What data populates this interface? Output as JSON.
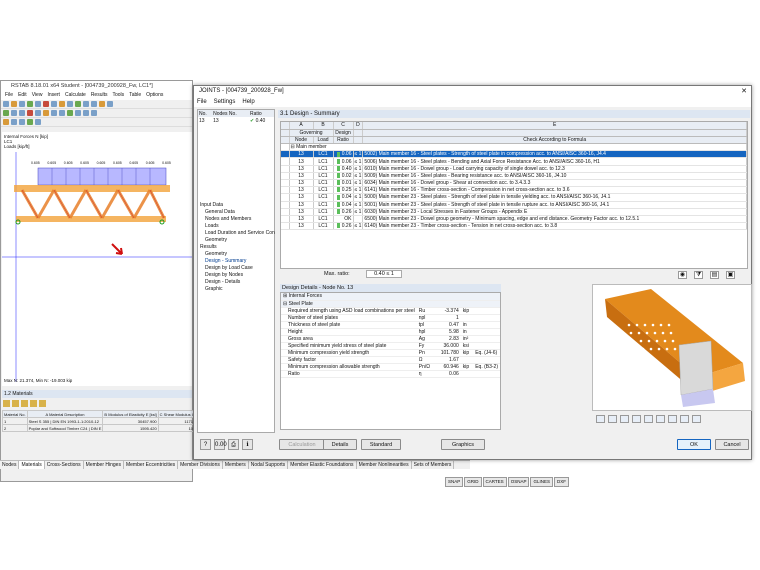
{
  "app": {
    "title": "RSTAB 8.18.01 x64 Student - [004739_200928_Fw, LC1*]",
    "menu": [
      "File",
      "Edit",
      "View",
      "Insert",
      "Calculate",
      "Results",
      "Tools",
      "Table",
      "Options"
    ],
    "viewport": {
      "line1": "Internal Forces N [kip]",
      "line2": "LC1",
      "line3": "Loads [kip/ft]",
      "status": "Max N: 21.374, Min N: -19.003 kip",
      "loads": [
        "0.605",
        "0.605",
        "0.605",
        "0.605",
        "0.605",
        "0.605",
        "0.605",
        "0.605",
        "0.605"
      ]
    },
    "materials": {
      "title": "1.2 Materials",
      "headers": [
        [
          "Material No.",
          "A Material Description",
          "B Modulus of Elasticity E [ksi]",
          "C Shear Modulus G [ksi]"
        ]
      ],
      "rows": [
        [
          "1",
          "Steel S 355 | DIN EN 1993-1-1:2010-12",
          "30457.900",
          "11714.600"
        ],
        [
          "2",
          "Poplar and Softwood Timber C24 | DIN E",
          "1595.420",
          "100.076"
        ]
      ]
    },
    "tabs": [
      "Nodes",
      "Materials",
      "Cross-Sections",
      "Member Hinges",
      "Member Eccentricities",
      "Member Divisions",
      "Members",
      "Nodal Supports",
      "Member Elastic Foundations",
      "Member Nonlinearities",
      "Sets of Members"
    ],
    "statusbar": [
      "SNAP",
      "GRID",
      "CARTES",
      "OSNAP",
      "GLINES",
      "DXF"
    ]
  },
  "dialog": {
    "title": "JOINTS - [004739_200928_Fw]",
    "menu": [
      "File",
      "Settings",
      "Help"
    ],
    "nav": {
      "h_no": "No.",
      "h_nodes": "Nodes No.",
      "h_ratio": "Ratio",
      "no": "13",
      "nodes": "13",
      "ratio": "0.40",
      "tree": [
        {
          "t": "Input Data",
          "l": 1
        },
        {
          "t": "General Data",
          "l": 2
        },
        {
          "t": "Nodes and Members",
          "l": 2
        },
        {
          "t": "Loads",
          "l": 2
        },
        {
          "t": "Load Duration and Service Con",
          "l": 2
        },
        {
          "t": "Geometry",
          "l": 2
        },
        {
          "t": "Results",
          "l": 1
        },
        {
          "t": "Geometry",
          "l": 2
        },
        {
          "t": "Design - Summary",
          "l": 2
        },
        {
          "t": "Design by Load Case",
          "l": 2
        },
        {
          "t": "Design by Nodes",
          "l": 2
        },
        {
          "t": "Design - Details",
          "l": 2
        },
        {
          "t": "Graphic",
          "l": 2
        }
      ]
    },
    "section": "3.1 Design - Summary",
    "grid": {
      "cols": [
        "A",
        "B",
        "C",
        "D",
        "E"
      ],
      "h_gov": "Governing",
      "h_node": "Node",
      "h_load": "Load",
      "h_design": "Design",
      "h_ratio": "Ratio",
      "h_check": "Check According to Formula",
      "group": "Main member",
      "rows": [
        [
          "13",
          "LC1",
          "0.06",
          "≤ 1",
          "5002) Main member 16 - Steel plates - Strength of steel plate in compression acc. to ANSI/AISC 360-16, J4.4"
        ],
        [
          "13",
          "LC1",
          "0.06",
          "≤ 1",
          "5006) Main member 16 - Steel plates - Bending and Axial Force Resistance Acc. to ANSI/AISC 360-16, H1"
        ],
        [
          "13",
          "LC1",
          "0.40",
          "≤ 1",
          "6010) Main member 16 - Dowel group - Load carrying capacity of single dowel acc. to 12.3"
        ],
        [
          "13",
          "LC1",
          "0.02",
          "≤ 1",
          "5009) Main member 16 - Steel plates - Bearing resistance acc. to ANSI/AISC 360-16, J4.10"
        ],
        [
          "13",
          "LC1",
          "0.01",
          "≤ 1",
          "6034) Main member 16 - Dowel group - Shear at connection acc. to 3.4.3.3"
        ],
        [
          "13",
          "LC1",
          "0.25",
          "≤ 1",
          "6141) Main member 16 - Timber cross-section - Compression in net cross-section acc. to 3.6"
        ],
        [
          "13",
          "LC1",
          "0.04",
          "≤ 1",
          "5000) Main member 23 - Steel plates - Strength of steel plate in tensile yielding acc. to ANSI/AISC 360-16, J4.1"
        ],
        [
          "13",
          "LC1",
          "0.04",
          "≤ 1",
          "5001) Main member 23 - Steel plates - Strength of steel plate in tensile rupture acc. to ANSI/AISC 360-16, J4.1"
        ],
        [
          "13",
          "LC1",
          "0.26",
          "≤ 1",
          "6030) Main member 23 - Local Stresses in Fastener Groups - Appendix E"
        ],
        [
          "13",
          "LC1",
          "OK",
          "",
          "6500) Main member 23 - Dowel group geometry - Minimum spacing, edge and end distance. Geometry Factor acc. to 12.5.1"
        ],
        [
          "13",
          "LC1",
          "0.26",
          "≤ 1",
          "6140) Main member 23 - Timber cross-section - Tension in net cross-section acc. to 3.8"
        ]
      ]
    },
    "max_label": "Max. ratio:",
    "max_value": "0.40 ≤ 1",
    "details": {
      "title": "Design Details - Node No. 13",
      "g1": "Internal Forces",
      "g2": "Steel Plate",
      "rows": [
        [
          "Required strength using ASD load combinations per steel",
          "Ru",
          "-3.374",
          "kip",
          ""
        ],
        [
          "Number of steel plates",
          "npl",
          "1",
          "",
          ""
        ],
        [
          "Thickness of steel plate",
          "tpl",
          "0.47",
          "in",
          ""
        ],
        [
          "Height",
          "hpl",
          "5.98",
          "in",
          ""
        ],
        [
          "Gross area",
          "Ag",
          "2.83",
          "in²",
          ""
        ],
        [
          "Specified minimum yield stress of steel plate",
          "Fy",
          "36.000",
          "ksi",
          ""
        ],
        [
          "Minimum compression yield strength",
          "Pn",
          "101.780",
          "kip",
          "Eq. (J4-6)"
        ],
        [
          "Safety factor",
          "Ω",
          "1.67",
          "",
          ""
        ],
        [
          "Minimum compression allowable strength",
          "Pn/Ω",
          "60.946",
          "kip",
          "Eq. (B3-2)"
        ],
        [
          "Ratio",
          "η",
          "0.06",
          "",
          ""
        ]
      ]
    },
    "buttons": {
      "calculation": "Calculation",
      "details": "Details",
      "standard": "Standard",
      "graphics": "Graphics",
      "ok": "OK",
      "cancel": "Cancel"
    }
  }
}
